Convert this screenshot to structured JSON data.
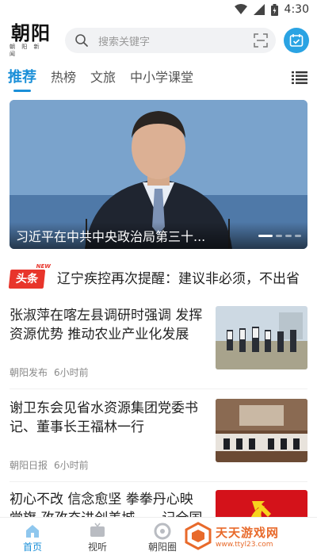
{
  "status": {
    "time": "4:30"
  },
  "header": {
    "logo_main": "朝阳",
    "logo_sub": "朝 阳 新 闻",
    "search_placeholder": "搜索关键字"
  },
  "tabs": [
    {
      "label": "推荐",
      "active": true
    },
    {
      "label": "热榜",
      "active": false
    },
    {
      "label": "文旅",
      "active": false
    },
    {
      "label": "中小学课堂",
      "active": false
    }
  ],
  "banner": {
    "title": "习近平在中共中央政治局第三十...",
    "slide_count": 4,
    "active_slide": 1
  },
  "headline": {
    "badge": "头条",
    "badge_new": "NEW",
    "text": "辽宁疾控再次提醒：建议非必须，不出省"
  },
  "news": [
    {
      "title": "张淑萍在喀左县调研时强调 发挥资源优势 推动农业产业化发展",
      "source": "朝阳发布",
      "time": "6小时前"
    },
    {
      "title": "谢卫东会见省水资源集团党委书记、董事长王福林一行",
      "source": "朝阳日报",
      "time": "6小时前"
    },
    {
      "title": "初心不改 信念愈坚 拳拳丹心映党旗 孜孜奋进创美城——记全国",
      "source": "",
      "time": ""
    }
  ],
  "bottom_nav": [
    {
      "label": "首页",
      "icon": "home-icon",
      "active": true
    },
    {
      "label": "视听",
      "icon": "tv-icon",
      "active": false
    },
    {
      "label": "朝阳圈",
      "icon": "circle-icon",
      "active": false
    }
  ],
  "watermark": {
    "name": "天天游戏网",
    "url": "www.ttyl23.com"
  },
  "colors": {
    "accent": "#1a8fd8",
    "badge_red": "#e8352b",
    "watermark": "#e86a2b"
  }
}
